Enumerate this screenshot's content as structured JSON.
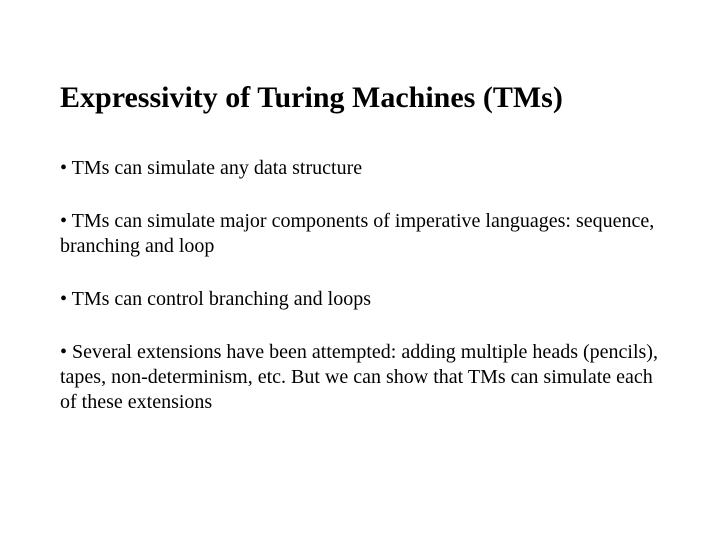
{
  "slide": {
    "title": "Expressivity of Turing Machines (TMs)",
    "bullets": [
      "TMs can simulate any data structure",
      "TMs can simulate major components of imperative languages: sequence, branching and loop",
      "TMs can control branching and loops",
      "Several extensions have been attempted: adding multiple heads (pencils), tapes, non-determinism, etc. But we can show that TMs can simulate each of these extensions"
    ]
  }
}
